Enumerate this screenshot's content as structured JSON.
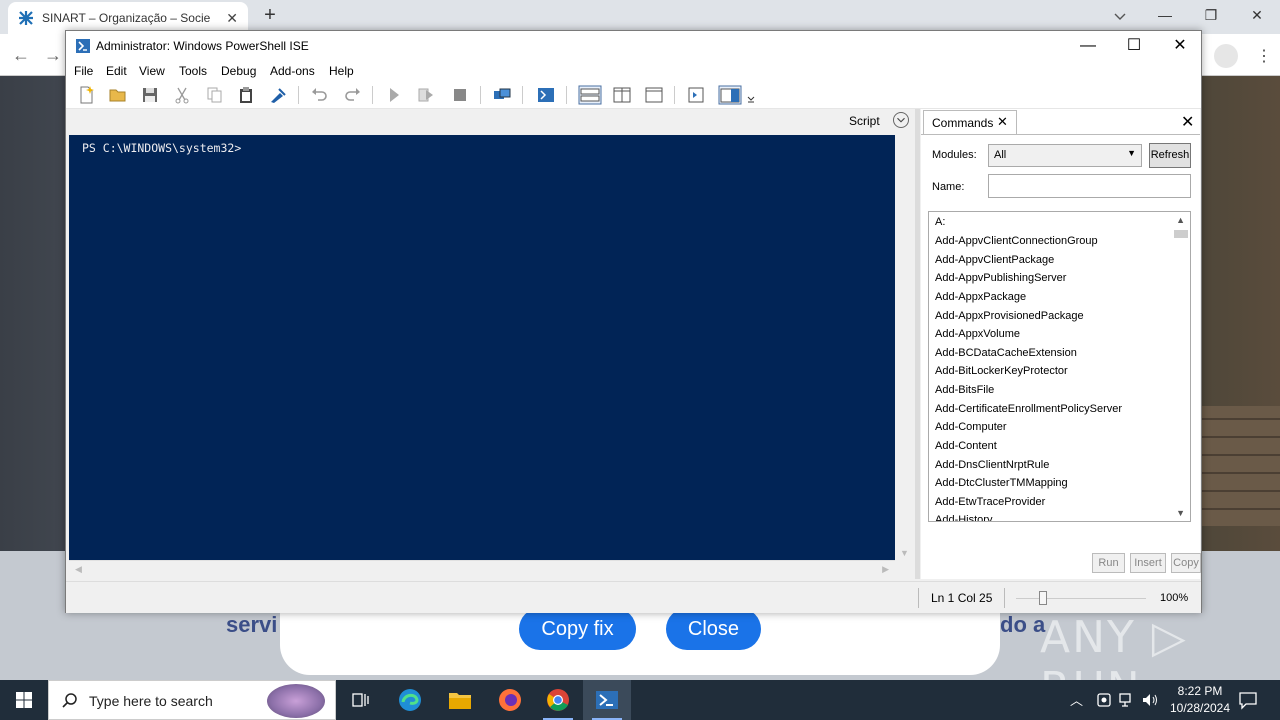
{
  "browser": {
    "tab_title": "SINART – Organização – Socieda",
    "tab_close": "✕",
    "new_tab": "+",
    "back": "←",
    "forward": "→",
    "minimize": "—",
    "restore": "❐",
    "close": "✕",
    "menu": "⋮"
  },
  "site": {
    "left_text": "servi",
    "right_text": "do a",
    "copy_fix_label": "Copy fix",
    "close_label": "Close",
    "watermark": "ANY ▷ RUN"
  },
  "ise": {
    "title": "Administrator: Windows PowerShell ISE",
    "minimize": "—",
    "maximize": "☐",
    "close": "✕",
    "menus": [
      "File",
      "Edit",
      "View",
      "Tools",
      "Debug",
      "Add-ons",
      "Help"
    ],
    "script_label": "Script",
    "prompt": "PS C:\\WINDOWS\\system32>",
    "status_position": "Ln 1  Col 25",
    "zoom": "100%",
    "zoom_level_percent": 100
  },
  "commands_panel": {
    "tab_label": "Commands",
    "tab_close": "✕",
    "panel_close": "✕",
    "modules_label": "Modules:",
    "modules_value": "All",
    "refresh_label": "Refresh",
    "name_label": "Name:",
    "name_value": "",
    "commands": [
      "A:",
      "Add-AppvClientConnectionGroup",
      "Add-AppvClientPackage",
      "Add-AppvPublishingServer",
      "Add-AppxPackage",
      "Add-AppxProvisionedPackage",
      "Add-AppxVolume",
      "Add-BCDataCacheExtension",
      "Add-BitLockerKeyProtector",
      "Add-BitsFile",
      "Add-CertificateEnrollmentPolicyServer",
      "Add-Computer",
      "Add-Content",
      "Add-DnsClientNrptRule",
      "Add-DtcClusterTMMapping",
      "Add-EtwTraceProvider",
      "Add-History"
    ],
    "run_label": "Run",
    "insert_label": "Insert",
    "copy_label": "Copy"
  },
  "taskbar": {
    "search_placeholder": "Type here to search",
    "time": "8:22 PM",
    "date": "10/28/2024"
  },
  "colors": {
    "console_bg": "#012456",
    "console_fg": "#eeedf0",
    "accent_blue": "#1a73e8",
    "taskbar_bg": "#202d3a"
  }
}
